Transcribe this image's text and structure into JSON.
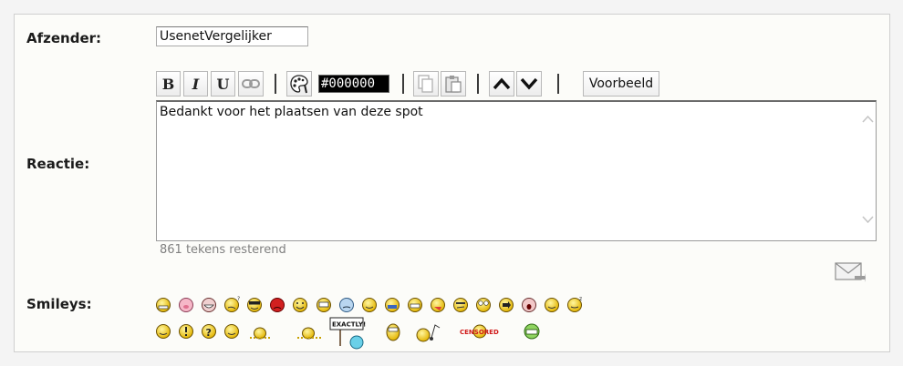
{
  "form": {
    "sender_label": "Afzender:",
    "sender_value": "UsenetVergelijker",
    "reaction_label": "Reactie:",
    "smileys_label": "Smileys:",
    "remaining_text": "861 tekens resterend"
  },
  "toolbar": {
    "bold_label": "B",
    "italic_label": "I",
    "underline_label": "U",
    "color_value": "#000000",
    "preview_label": "Voorbeeld"
  },
  "message": {
    "text": "Bedankt voor het plaatsen van deze spot"
  },
  "smileys": {
    "exactly_sign": "EXACTLY!",
    "censored_sign": "CENSORED",
    "zz_text": "z"
  },
  "colors": {
    "smiley_yellow": "#f7d81b",
    "accent": "#000000"
  }
}
